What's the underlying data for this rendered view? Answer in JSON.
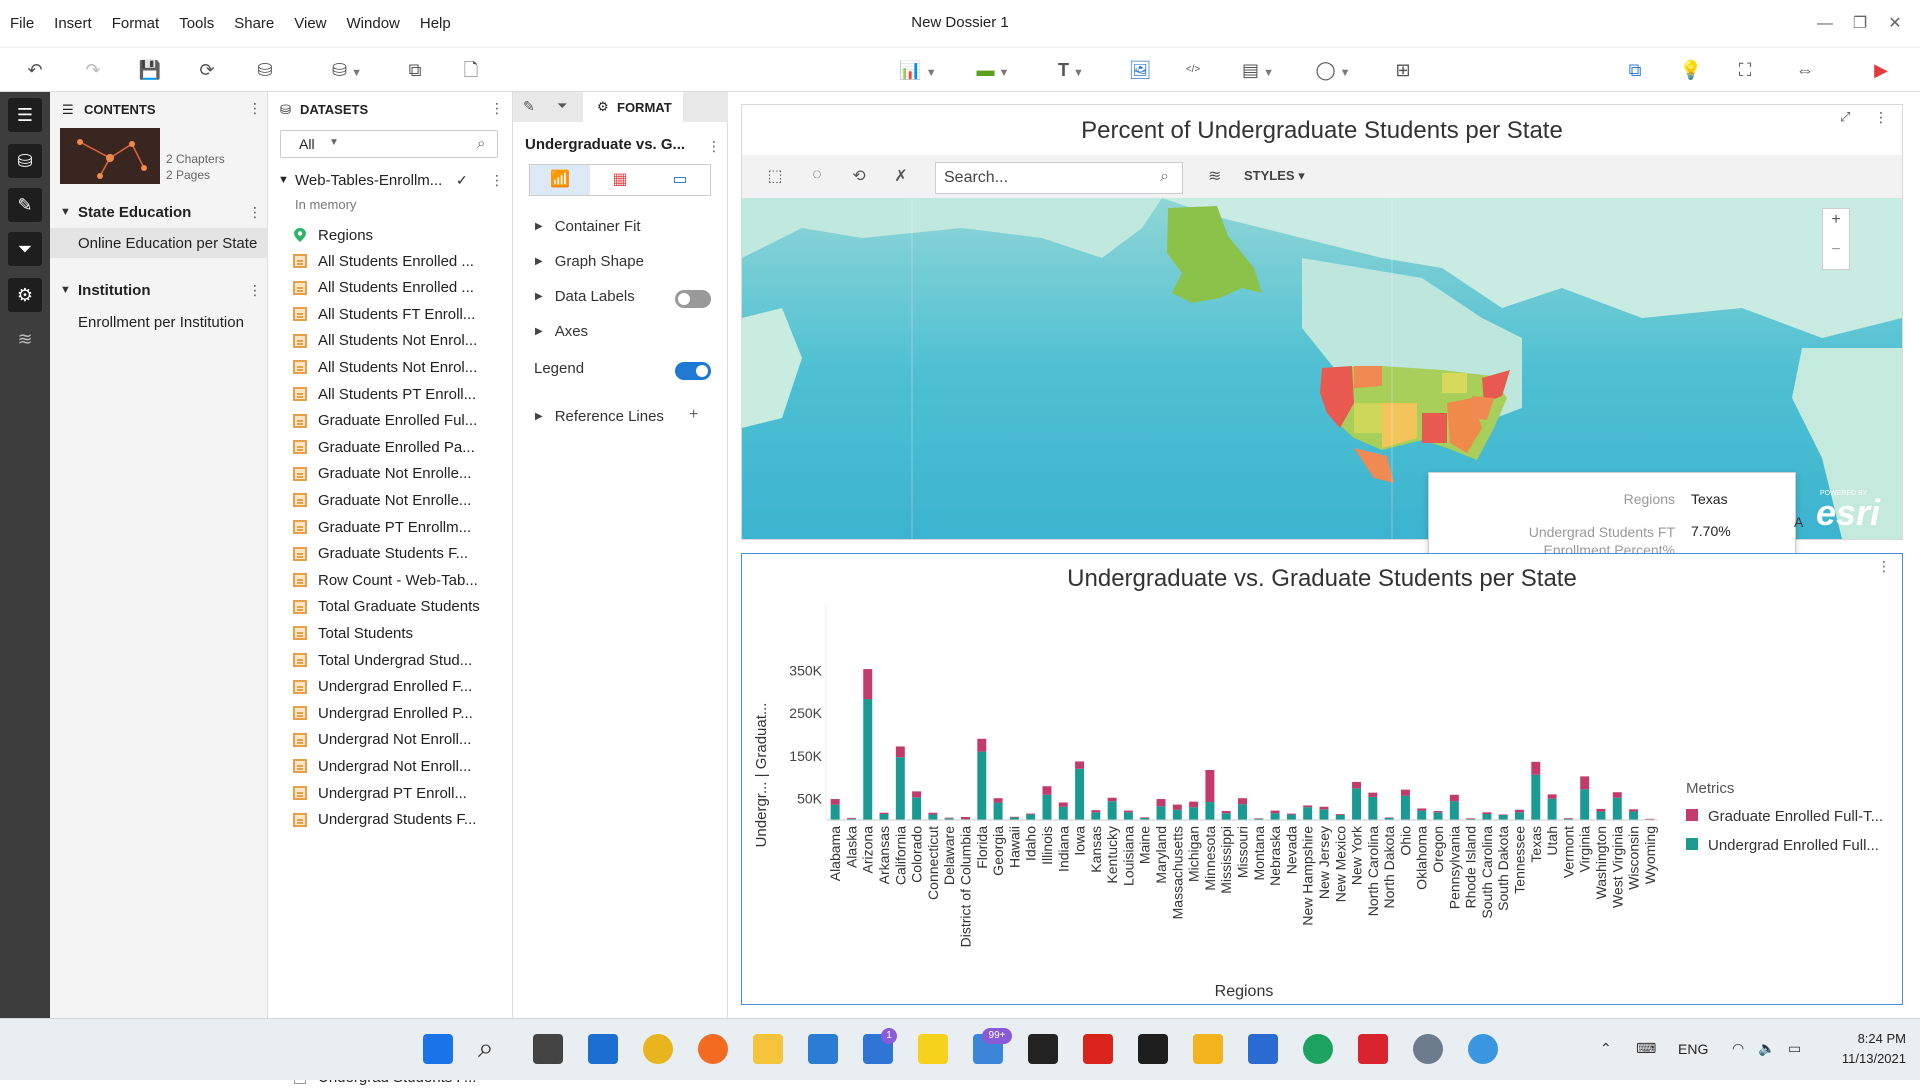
{
  "menu": {
    "items": [
      "File",
      "Insert",
      "Format",
      "Tools",
      "Share",
      "View",
      "Window",
      "Help"
    ],
    "title": "New Dossier 1"
  },
  "contents": {
    "header": "CONTENTS",
    "thumb_chapters": "2 Chapters",
    "thumb_pages": "2 Pages",
    "chapters": [
      {
        "name": "State Education",
        "pages": [
          "Online Education per State"
        ]
      },
      {
        "name": "Institution",
        "pages": [
          "Enrollment per Institution"
        ]
      }
    ]
  },
  "datasets": {
    "header": "DATASETS",
    "filter_value": "All",
    "dataset_name": "Web-Tables-Enrollm...",
    "dataset_status": "In memory",
    "geo_item": "Regions",
    "items": [
      "All Students Enrolled ...",
      "All Students Enrolled ...",
      "All Students FT Enroll...",
      "All Students Not Enrol...",
      "All Students Not Enrol...",
      "All Students PT Enroll...",
      "Graduate Enrolled Ful...",
      "Graduate Enrolled Pa...",
      "Graduate Not Enrolle...",
      "Graduate Not Enrolle...",
      "Graduate PT Enrollm...",
      "Graduate Students F...",
      "Row Count - Web-Tab...",
      "Total Graduate Students",
      "Total Students",
      "Total Undergrad Stud...",
      "Undergrad Enrolled F...",
      "Undergrad Enrolled P...",
      "Undergrad Not Enroll...",
      "Undergrad Not Enroll...",
      "Undergrad PT Enroll...",
      "Undergrad Students F..."
    ],
    "last_item": "Undergrad Students F..."
  },
  "format": {
    "tab": "FORMAT",
    "viz_name": "Undergraduate vs. G...",
    "sections": [
      "Container Fit",
      "Graph Shape",
      "Data Labels",
      "Axes"
    ],
    "legend_label": "Legend",
    "legend_on": true,
    "data_labels_on": false,
    "reference_lines": "Reference Lines"
  },
  "map": {
    "title": "Percent of Undergraduate Students per State",
    "search_placeholder": "Search...",
    "styles_label": "STYLES",
    "zoom_in": "+",
    "zoom_out": "−",
    "esri_small": "POWERED BY",
    "esri": "esri",
    "tooltip": {
      "k1": "Regions",
      "v1": "Texas",
      "k2": "Undergrad Students FT Enrollment Percent%",
      "v2": "7.70%",
      "edge_char": "A"
    }
  },
  "chart_data": {
    "type": "bar",
    "stacked": true,
    "title": "Undergraduate vs. Graduate Students per State",
    "xlabel": "Regions",
    "ylabel": "Undergr...   |   Graduat...",
    "yticks": [
      "350K",
      "250K",
      "150K",
      "50K"
    ],
    "ylim": [
      0,
      400000
    ],
    "categories": [
      "Alabama",
      "Alaska",
      "Arizona",
      "Arkansas",
      "California",
      "Colorado",
      "Connecticut",
      "Delaware",
      "District of Columbia",
      "Florida",
      "Georgia",
      "Hawaii",
      "Idaho",
      "Illinois",
      "Indiana",
      "Iowa",
      "Kansas",
      "Kentucky",
      "Louisiana",
      "Maine",
      "Maryland",
      "Massachusetts",
      "Michigan",
      "Minnesota",
      "Mississippi",
      "Missouri",
      "Montana",
      "Nebraska",
      "Nevada",
      "New Hampshire",
      "New Jersey",
      "New Mexico",
      "New York",
      "North Carolina",
      "North Dakota",
      "Ohio",
      "Oklahoma",
      "Oregon",
      "Pennsylvania",
      "Rhode Island",
      "South Carolina",
      "South Dakota",
      "Tennessee",
      "Texas",
      "Utah",
      "Vermont",
      "Virginia",
      "Washington",
      "West Virginia",
      "Wisconsin",
      "Wyoming"
    ],
    "series": [
      {
        "name": "Graduate Enrolled Full-T...",
        "color": "#c23b6a",
        "values": [
          13000,
          2000,
          70000,
          3000,
          25000,
          14000,
          4000,
          1500,
          5000,
          30000,
          10000,
          1500,
          2000,
          20000,
          10000,
          17000,
          5000,
          8000,
          4000,
          1500,
          17000,
          12000,
          13000,
          75000,
          5000,
          14000,
          1000,
          6000,
          2000,
          4000,
          6000,
          2000,
          15000,
          10000,
          1000,
          14000,
          5000,
          3000,
          15000,
          1500,
          4000,
          1000,
          6000,
          30000,
          10000,
          1500,
          30000,
          6000,
          13000,
          5000,
          800
        ]
      },
      {
        "name": "Undergrad Enrolled Full...",
        "color": "#1a9a92",
        "values": [
          36000,
          3000,
          283000,
          14000,
          147000,
          53000,
          13000,
          4000,
          2000,
          160000,
          41000,
          6000,
          13000,
          59000,
          31000,
          120000,
          18000,
          44000,
          18000,
          5000,
          32000,
          24000,
          30000,
          42000,
          16000,
          37000,
          3000,
          16000,
          13000,
          30000,
          25000,
          12000,
          74000,
          54000,
          5000,
          57000,
          22000,
          18000,
          44000,
          2500,
          14000,
          12000,
          18000,
          106000,
          50000,
          3000,
          72000,
          20000,
          52000,
          20000,
          2000
        ]
      }
    ]
  },
  "legend": {
    "title": "Metrics"
  },
  "taskbar": {
    "lang": "ENG",
    "time": "8:24 PM",
    "date": "11/13/2021",
    "badge_todo": "1",
    "badge_mail": "99+"
  }
}
